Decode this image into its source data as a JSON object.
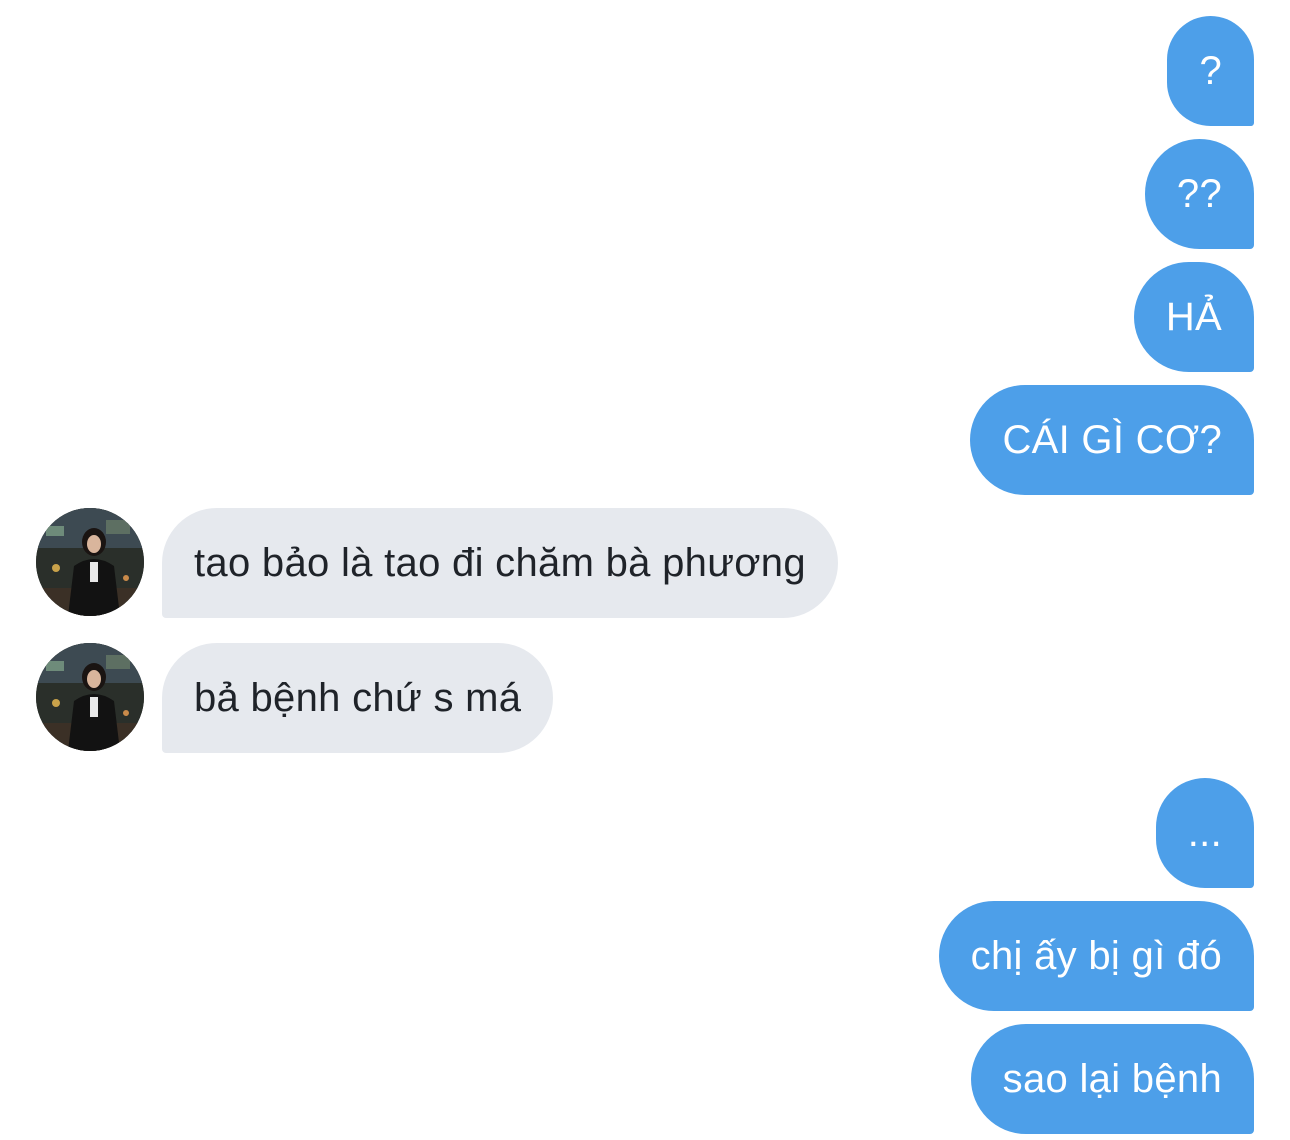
{
  "messages": [
    {
      "side": "out",
      "text": "?"
    },
    {
      "side": "out",
      "text": "??"
    },
    {
      "side": "out",
      "text": "HẢ"
    },
    {
      "side": "out",
      "text": "CÁI GÌ CƠ?"
    },
    {
      "side": "in",
      "text": "tao bảo là tao đi chăm bà phương",
      "avatar": "contact-avatar"
    },
    {
      "side": "in",
      "text": "bả bệnh chứ s má",
      "avatar": "contact-avatar"
    },
    {
      "side": "out",
      "text": "..."
    },
    {
      "side": "out",
      "text": "chị ấy bị gì đó"
    },
    {
      "side": "out",
      "text": "sao lại bệnh"
    }
  ],
  "colors": {
    "outgoing_bubble": "#4d9fe9",
    "incoming_bubble": "#e6e9ee",
    "outgoing_text": "#ffffff",
    "incoming_text": "#1f2329",
    "background": "#ffffff"
  }
}
